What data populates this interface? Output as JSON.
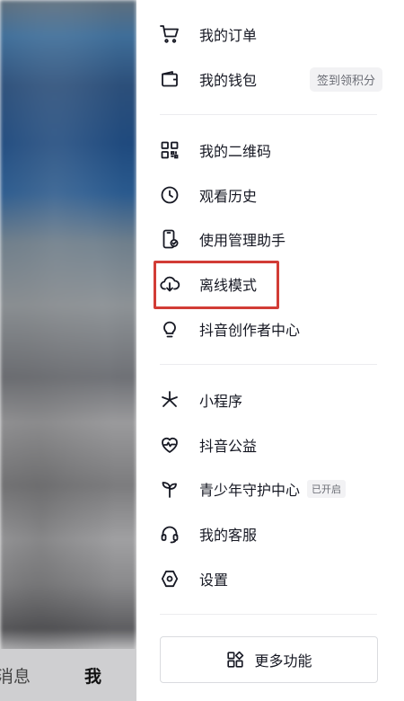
{
  "background": {
    "tabs": [
      {
        "label": "消息"
      },
      {
        "label": "我"
      }
    ]
  },
  "drawer": {
    "sections": [
      {
        "items": [
          {
            "label": "我的订单",
            "icon": "cart-icon"
          },
          {
            "label": "我的钱包",
            "icon": "wallet-icon",
            "badge": "签到领积分"
          }
        ]
      },
      {
        "items": [
          {
            "label": "我的二维码",
            "icon": "qr-code-icon"
          },
          {
            "label": "观看历史",
            "icon": "clock-icon"
          },
          {
            "label": "使用管理助手",
            "icon": "phone-check-icon"
          },
          {
            "label": "离线模式",
            "icon": "cloud-download-icon"
          },
          {
            "label": "抖音创作者中心",
            "icon": "lightbulb-icon"
          }
        ]
      },
      {
        "items": [
          {
            "label": "小程序",
            "icon": "asterisk-icon"
          },
          {
            "label": "抖音公益",
            "icon": "heart-pulse-icon"
          },
          {
            "label": "青少年守护中心",
            "icon": "sprout-icon",
            "badge": "已开启"
          },
          {
            "label": "我的客服",
            "icon": "headset-icon"
          },
          {
            "label": "设置",
            "icon": "hexagon-settings-icon"
          }
        ]
      }
    ],
    "more_button": {
      "label": "更多功能",
      "icon": "apps-icon"
    }
  },
  "colors": {
    "highlight_border": "#d23c36",
    "text_primary": "#161823",
    "badge_bg": "#f2f2f4"
  }
}
